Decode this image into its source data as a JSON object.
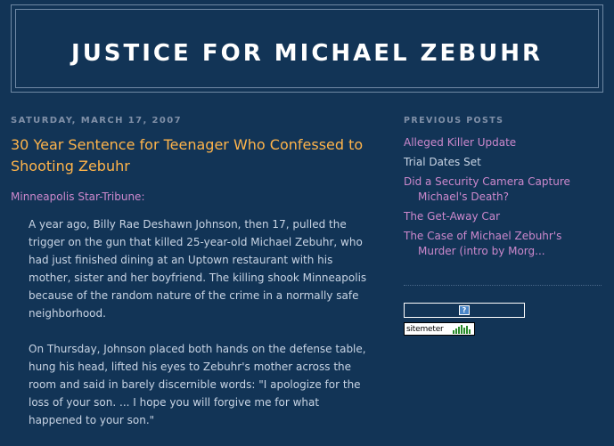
{
  "blog": {
    "title": "JUSTICE FOR MICHAEL ZEBUHR"
  },
  "post": {
    "date": "SATURDAY, MARCH 17, 2007",
    "title": "30 Year Sentence for Teenager Who Confessed to Shooting Zebuhr",
    "source": "Minneapolis Star-Tribune:",
    "paragraphs": [
      "A year ago, Billy Rae Deshawn Johnson, then 17, pulled the trigger on the gun that killed 25-year-old Michael Zebuhr, who had just finished dining at an Uptown restaurant with his mother, sister and her boyfriend. The killing shook Minneapolis because of the random nature of the crime in a normally safe neighborhood.",
      "On Thursday, Johnson placed both hands on the defense table, hung his head, lifted his eyes to Zebuhr's mother across the room and said in barely discernible words: \"I apologize for the loss of your son. ... I hope you will forgive me for what happened to your son.\""
    ]
  },
  "sidebar": {
    "title": "PREVIOUS POSTS",
    "items": [
      {
        "label": "Alleged Killer Update",
        "visited": false
      },
      {
        "label": "Trial Dates Set",
        "visited": true
      },
      {
        "label": "Did a Security Camera Capture Michael's Death?",
        "visited": false
      },
      {
        "label": "The Get-Away Car",
        "visited": false
      },
      {
        "label": "The Case of Michael Zebuhr's Murder (intro by Morg...",
        "visited": false
      }
    ]
  },
  "sitemeter": {
    "question_icon": "question-icon",
    "badge_label": "sitemeter"
  },
  "colors": {
    "background": "#123456",
    "title": "#ffffff",
    "post_title": "#ffb44a",
    "link": "#cc88cc",
    "text": "#c8d4e4",
    "date": "#8090a8"
  }
}
